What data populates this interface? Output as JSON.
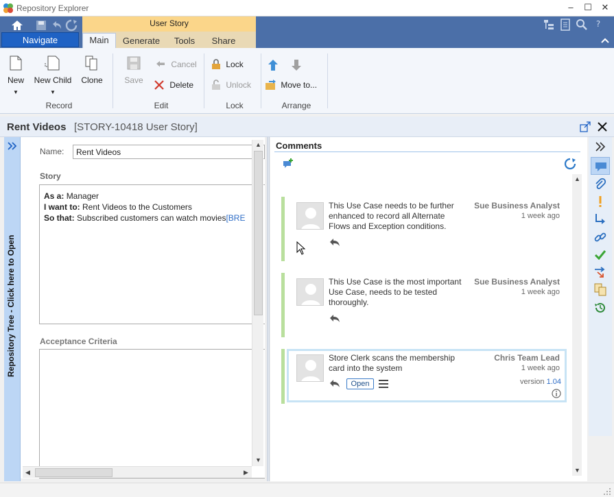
{
  "window": {
    "title": "Repository Explorer",
    "minimize": "‒",
    "maximize": "☐",
    "close": "✕"
  },
  "ribbon": {
    "context_tab": "User Story",
    "navigate": "Navigate",
    "tabs": [
      "Main",
      "Generate",
      "Tools",
      "Share"
    ],
    "groups": {
      "record": {
        "label": "Record",
        "new": "New",
        "new_child": "New Child",
        "clone": "Clone"
      },
      "edit": {
        "label": "Edit",
        "save": "Save",
        "cancel": "Cancel",
        "delete": "Delete"
      },
      "lock": {
        "label": "Lock",
        "lock": "Lock",
        "unlock": "Unlock"
      },
      "arrange": {
        "label": "Arrange",
        "move_to": "Move to..."
      }
    }
  },
  "panel": {
    "title": "Rent Videos",
    "subtitle": "[STORY-10418 User Story]"
  },
  "repo_tree": {
    "label": "Repository Tree - Click here to Open"
  },
  "form": {
    "name_label": "Name:",
    "name_value": "Rent Videos",
    "story_label": "Story",
    "story": {
      "as_a_label": "As a:",
      "as_a": "Manager",
      "want_label": "I want to:",
      "want": "Rent Videos to the Customers",
      "so_that_label": "So that:",
      "so_that": "Subscribed customers can watch movies",
      "link": "[BRE"
    },
    "acceptance_label": "Acceptance Criteria"
  },
  "comments": {
    "title": "Comments",
    "items": [
      {
        "text": "This Use Case needs to be further enhanced to record all Alternate Flows and Exception conditions.",
        "author": "Sue Business Analyst",
        "time": "1 week ago"
      },
      {
        "text": "This Use Case is the most important Use Case, needs to be tested thoroughly.",
        "author": "Sue Business Analyst",
        "time": "1 week ago"
      },
      {
        "text": "Store Clerk scans the membership card into the system",
        "author": "Chris Team Lead",
        "time": "1 week ago",
        "status": "Open",
        "version_label": "version",
        "version": "1.04"
      }
    ]
  },
  "colors": {
    "ribbon": "#4b6fa8",
    "navigate": "#1f62c4",
    "context": "#fbd68a",
    "comment_bar": "#b9df9d",
    "link": "#2c6cc6"
  }
}
